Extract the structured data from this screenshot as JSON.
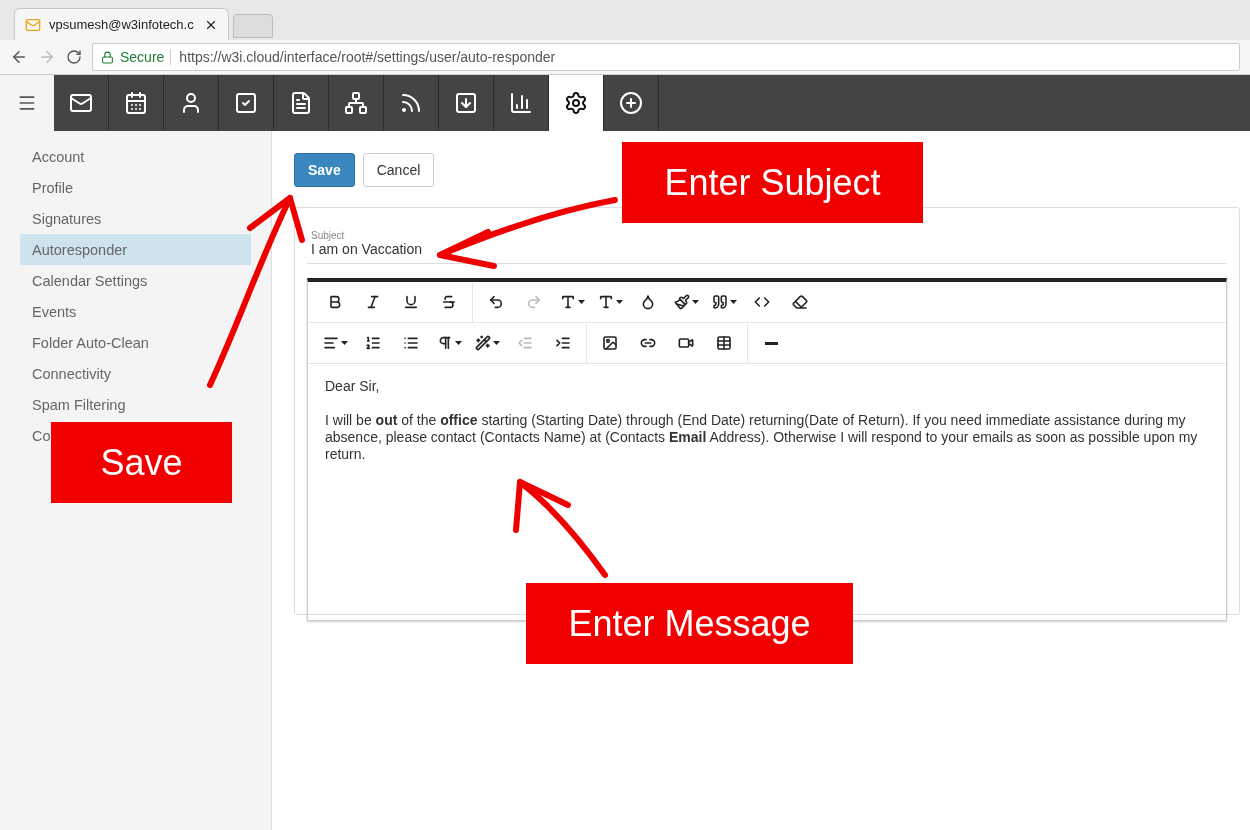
{
  "browser": {
    "tab_title": "vpsumesh@w3infotech.c",
    "secure_label": "Secure",
    "url": "https://w3i.cloud/interface/root#/settings/user/auto-responder"
  },
  "app_bar": [
    {
      "kind": "mail",
      "selected": false
    },
    {
      "kind": "calendar",
      "selected": false
    },
    {
      "kind": "contacts",
      "selected": false
    },
    {
      "kind": "tasks",
      "selected": false
    },
    {
      "kind": "notes",
      "selected": false
    },
    {
      "kind": "org",
      "selected": false
    },
    {
      "kind": "feeds",
      "selected": false
    },
    {
      "kind": "inbox",
      "selected": false
    },
    {
      "kind": "reports",
      "selected": false
    },
    {
      "kind": "settings",
      "selected": true
    },
    {
      "kind": "add",
      "selected": false
    }
  ],
  "sidebar": {
    "items": [
      {
        "label": "Account",
        "selected": false
      },
      {
        "label": "Profile",
        "selected": false
      },
      {
        "label": "Signatures",
        "selected": false
      },
      {
        "label": "Autoresponder",
        "selected": true
      },
      {
        "label": "Calendar Settings",
        "selected": false
      },
      {
        "label": "Events",
        "selected": false
      },
      {
        "label": "Folder Auto-Clean",
        "selected": false
      },
      {
        "label": "Connectivity",
        "selected": false
      },
      {
        "label": "Spam Filtering",
        "selected": false
      },
      {
        "label": "Co",
        "selected": false
      }
    ]
  },
  "actions": {
    "save": "Save",
    "cancel": "Cancel"
  },
  "subject": {
    "label": "Subject",
    "value": "I am on Vaccation"
  },
  "message": {
    "paragraphs": [
      "Dear Sir,",
      "I will be **out** of the **office** starting (Starting Date) through (End Date) returning(Date of Return). If you need immediate assistance during my absence, please contact (Contacts Name) at (Contacts **Email** Address). Otherwise I will respond to your emails as soon as possible upon my return."
    ]
  },
  "annotations": [
    {
      "text": "Enter Subject"
    },
    {
      "text": "Save"
    },
    {
      "text": "Enter Message"
    }
  ]
}
